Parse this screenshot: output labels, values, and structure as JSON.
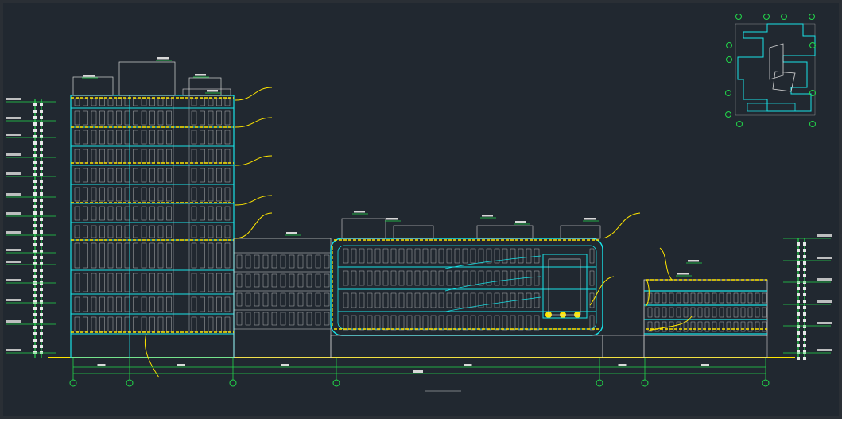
{
  "drawing": {
    "title": "",
    "background": "#212830",
    "colors": {
      "cyan": "#19e3e8",
      "white": "#d8d8d8",
      "yellow": "#ffe600",
      "green": "#22d84a",
      "grey": "#9aa0a6"
    }
  },
  "axes": {
    "left_labels": [
      "",
      "",
      "",
      "",
      "",
      "",
      ""
    ]
  },
  "key_plan": {
    "icon": "key-plan-icon"
  }
}
